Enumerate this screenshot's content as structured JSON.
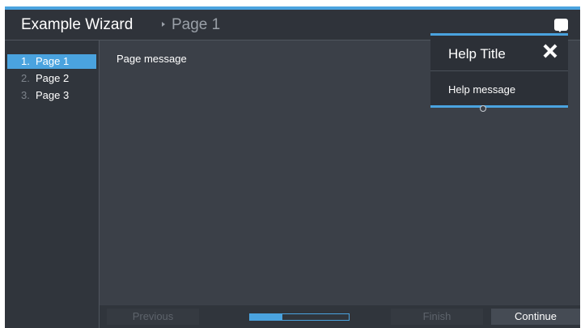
{
  "header": {
    "title": "Example Wizard",
    "breadcrumb_page": "Page 1",
    "help_icon": "speech-bubble-icon"
  },
  "sidebar": {
    "steps": [
      {
        "number": "1.",
        "label": "Page 1",
        "active": true
      },
      {
        "number": "2.",
        "label": "Page 2",
        "active": false
      },
      {
        "number": "3.",
        "label": "Page 3",
        "active": false
      }
    ]
  },
  "main": {
    "message": "Page message"
  },
  "help_popover": {
    "title": "Help Title",
    "message": "Help message",
    "close_icon": "close-icon"
  },
  "footer": {
    "previous_label": "Previous",
    "finish_label": "Finish",
    "continue_label": "Continue",
    "progress": 0.33
  },
  "colors": {
    "accent": "#4aa3df",
    "background": "#3b4048",
    "sidebar": "#30353c"
  }
}
